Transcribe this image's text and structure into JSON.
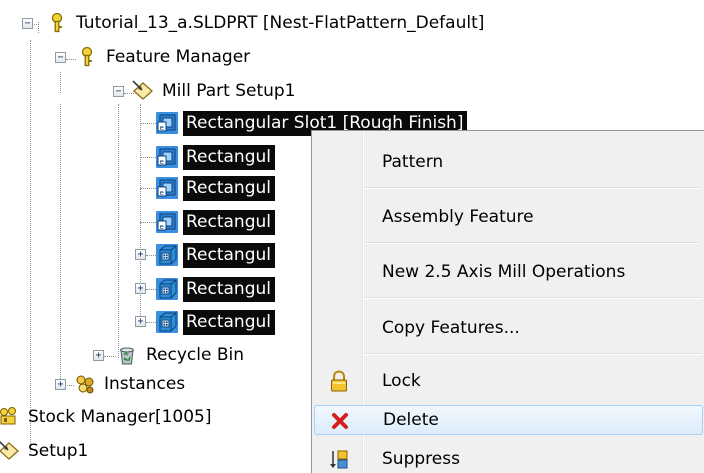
{
  "tree": {
    "root": {
      "label": "Tutorial_13_a.SLDPRT [Nest-FlatPattern_Default]",
      "expander": "−"
    },
    "feature_manager": {
      "label": "Feature Manager",
      "expander": "−"
    },
    "mill_setup": {
      "label": "Mill Part Setup1",
      "expander": "−"
    },
    "slots": [
      {
        "label": "Rectangular Slot1 [Rough Finish]"
      },
      {
        "label": "Rectangul"
      },
      {
        "label": "Rectangul"
      },
      {
        "label": "Rectangul"
      }
    ],
    "pockets": [
      {
        "label": "Rectangul",
        "expander": "+"
      },
      {
        "label": "Rectangul",
        "expander": "+"
      },
      {
        "label": "Rectangul",
        "expander": "+"
      }
    ],
    "recycle_bin": {
      "label": "Recycle Bin",
      "expander": "+"
    },
    "instances": {
      "label": "Instances",
      "expander": "+"
    },
    "stock_manager": {
      "label": "Stock Manager[1005]"
    },
    "setup1": {
      "label": "Setup1"
    }
  },
  "context_menu": {
    "items": [
      {
        "label": "Pattern"
      },
      {
        "label": "Assembly Feature"
      },
      {
        "label": "New 2.5 Axis Mill Operations"
      },
      {
        "label": "Copy Features..."
      },
      {
        "label": "Lock",
        "icon": "lock-icon"
      },
      {
        "label": "Delete",
        "icon": "delete-x-icon"
      },
      {
        "label": "Suppress",
        "icon": "suppress-icon"
      }
    ]
  },
  "colors": {
    "selection_bg": "#0a0a0a",
    "selection_text": "#ffffff",
    "menu_bg": "#f0f0f0",
    "menu_hover": "#dcecfb",
    "delete_red": "#d42020"
  }
}
